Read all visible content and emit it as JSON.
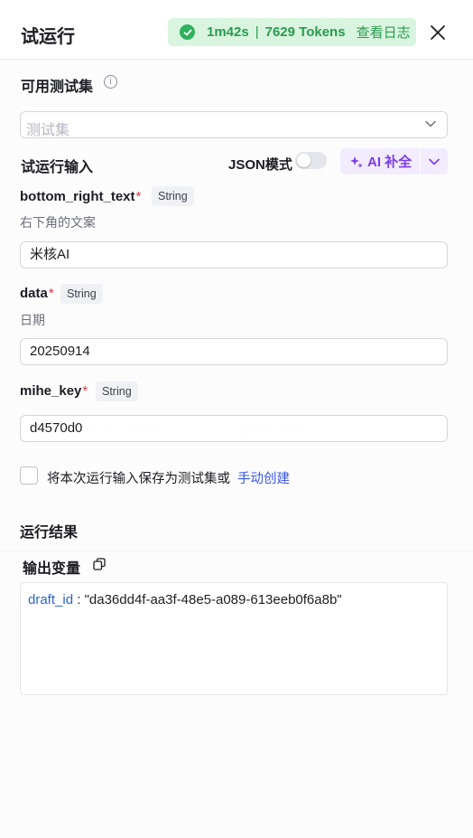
{
  "header": {
    "title": "试运行",
    "status": {
      "time": "1m42s",
      "separator": "|",
      "tokens": "7629 Tokens",
      "log_link": "查看日志"
    }
  },
  "testset": {
    "label": "可用测试集",
    "placeholder": "测试集"
  },
  "input_section": {
    "label": "试运行输入",
    "json_mode_label": "JSON模式",
    "json_mode_on": false,
    "ai_button_label": "AI 补全"
  },
  "fields": [
    {
      "name": "bottom_right_text",
      "required": "*",
      "type": "String",
      "description": "右下角的文案",
      "value": "米核AI"
    },
    {
      "name": "data",
      "required": "*",
      "type": "String",
      "description": "日期",
      "value": "20250914"
    },
    {
      "name": "mihe_key",
      "required": "*",
      "type": "String",
      "description": "",
      "value": "d4570d0"
    }
  ],
  "save_option": {
    "text": "将本次运行输入保存为测试集或",
    "link": "手动创建",
    "checked": false
  },
  "result": {
    "title": "运行结果",
    "output_label": "输出变量",
    "key": "draft_id",
    "colon": " : ",
    "value": "\"da36dd4f-aa3f-48e5-a089-613eeb0f6a8b\""
  },
  "colors": {
    "accent_purple": "#7c3aed",
    "success_green": "#2fb15d",
    "link_blue": "#3a56e4",
    "required_red": "#e2334a"
  }
}
